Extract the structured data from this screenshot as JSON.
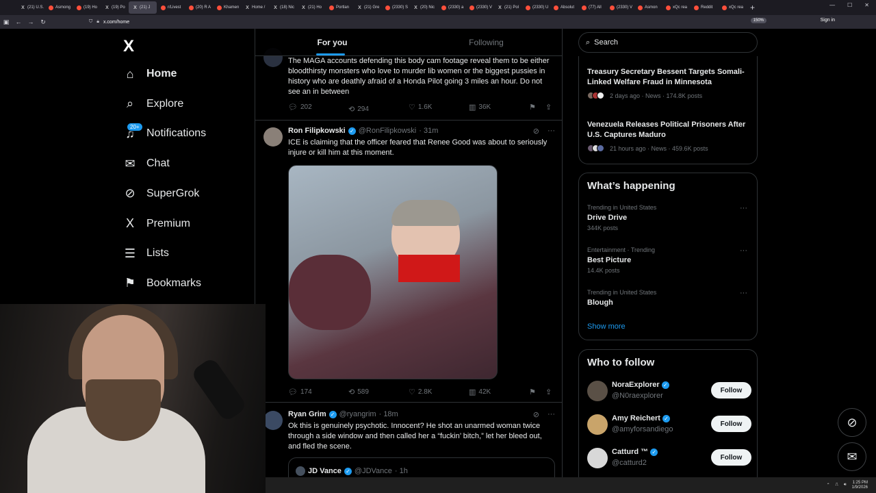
{
  "browser": {
    "tabs": [
      "(21) U.S.",
      "Asmong",
      "(19) Ho",
      "(19) Po",
      "(21) J",
      "r/Livest",
      "(20) R A",
      "Khamen",
      "Home /",
      "(18) Nic",
      "(21) Ho",
      "Portlan",
      "(21) Gre",
      "(2330) S",
      "(20) Nic",
      "(2330) a",
      "(2330) V",
      "(21) Pol",
      "(2330) U",
      "Absolut",
      "(77) All",
      "(2330) V",
      "Asmon",
      "xQc rea",
      "Reddit",
      "xQc rea"
    ],
    "new_tab": "+",
    "url": "x.com/home",
    "zoom": "150%",
    "signin": "Sign in"
  },
  "nav": {
    "logo": "X",
    "items": [
      {
        "label": "Home",
        "icon": "home-icon",
        "glyph": "⌂"
      },
      {
        "label": "Explore",
        "icon": "search-icon",
        "glyph": "⌕"
      },
      {
        "label": "Notifications",
        "icon": "bell-icon",
        "glyph": "♫"
      },
      {
        "label": "Chat",
        "icon": "mail-icon",
        "glyph": "✉"
      },
      {
        "label": "SuperGrok",
        "icon": "grok-icon",
        "glyph": "⊘"
      },
      {
        "label": "Premium",
        "icon": "x-icon",
        "glyph": "X"
      },
      {
        "label": "Lists",
        "icon": "list-icon",
        "glyph": "☰"
      },
      {
        "label": "Bookmarks",
        "icon": "bookmark-icon",
        "glyph": "⚑"
      }
    ],
    "notifications_badge": "20+"
  },
  "feed": {
    "tabs": [
      "For you",
      "Following"
    ],
    "posts": [
      {
        "text": "The MAGA accounts defending this body cam footage reveal them to be either bloodthirsty monsters who love to murder lib women or the biggest pussies in history who are deathly afraid of a Honda Pilot going 3 miles an hour.  Do not see an in between",
        "replies": "202",
        "reposts": "294",
        "likes": "1.6K",
        "views": "36K"
      },
      {
        "name": "Ron Filipkowski",
        "handle": "@RonFilipkowski",
        "time": "· 31m",
        "text": "ICE is claiming that the officer feared that Renee Good was about to seriously injure or kill him at this moment.",
        "replies": "174",
        "reposts": "589",
        "likes": "2.8K",
        "views": "42K"
      },
      {
        "name": "Ryan Grim",
        "handle": "@ryangrim",
        "time": "· 18m",
        "text": "Ok this is genuinely psychotic. Innocent? He shot an unarmed woman twice through a side window and then called her a “fuckin’ bitch,” let her bleed out, and fled the scene.",
        "quote": {
          "name": "JD Vance",
          "handle": "@JDVance",
          "time": "· 1h"
        }
      }
    ]
  },
  "sidebar": {
    "search_placeholder": "Search",
    "news": [
      {
        "headline": "Treasury Secretary Bessent Targets Somali-Linked Welfare Fraud in Minnesota",
        "meta": "2 days ago · News · 174.8K posts"
      },
      {
        "headline": "Venezuela Releases Political Prisoners After U.S. Captures Maduro",
        "meta": "21 hours ago · News · 459.6K posts"
      }
    ],
    "whats_happening": {
      "title": "What’s happening",
      "trends": [
        {
          "context": "Trending in United States",
          "name": "Drive Drive",
          "posts": "344K posts"
        },
        {
          "context": "Entertainment · Trending",
          "name": "Best Picture",
          "posts": "14.4K posts"
        },
        {
          "context": "Trending in United States",
          "name": "Blough",
          "posts": ""
        }
      ],
      "show_more": "Show more"
    },
    "who_to_follow": {
      "title": "Who to follow",
      "accounts": [
        {
          "name": "NoraExplorer",
          "handle": "@N0raexplorer",
          "button": "Follow",
          "color": "#5a5046"
        },
        {
          "name": "Amy Reichert",
          "handle": "@amyforsandiego",
          "button": "Follow",
          "color": "#c9a46a"
        },
        {
          "name": "Catturd ™",
          "handle": "@catturd2",
          "button": "Follow",
          "color": "#d8d8d8"
        }
      ]
    }
  },
  "taskbar": {
    "time": "1:25 PM",
    "date": "1/9/2026"
  },
  "colors": {
    "accent": "#1d9bf0",
    "bg": "#000000",
    "border": "#2f3336",
    "muted": "#71767b"
  }
}
